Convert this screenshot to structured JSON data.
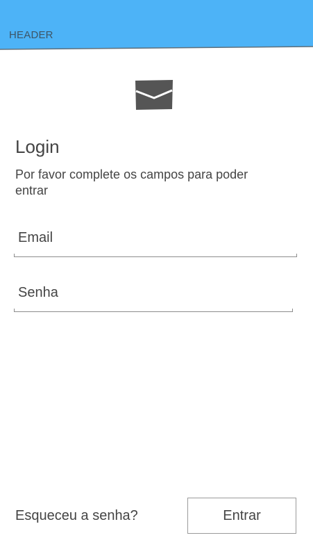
{
  "header": {
    "title": "HEADER",
    "background_color": "#4db3f7"
  },
  "logo": {
    "icon": "envelope-icon",
    "color": "#555555"
  },
  "login": {
    "title": "Login",
    "subtitle": "Por favor complete os campos para poder entrar"
  },
  "form": {
    "email": {
      "placeholder": "Email",
      "value": ""
    },
    "password": {
      "placeholder": "Senha",
      "value": ""
    }
  },
  "footer": {
    "forgot_password_label": "Esqueceu a senha?",
    "submit_label": "Entrar"
  }
}
